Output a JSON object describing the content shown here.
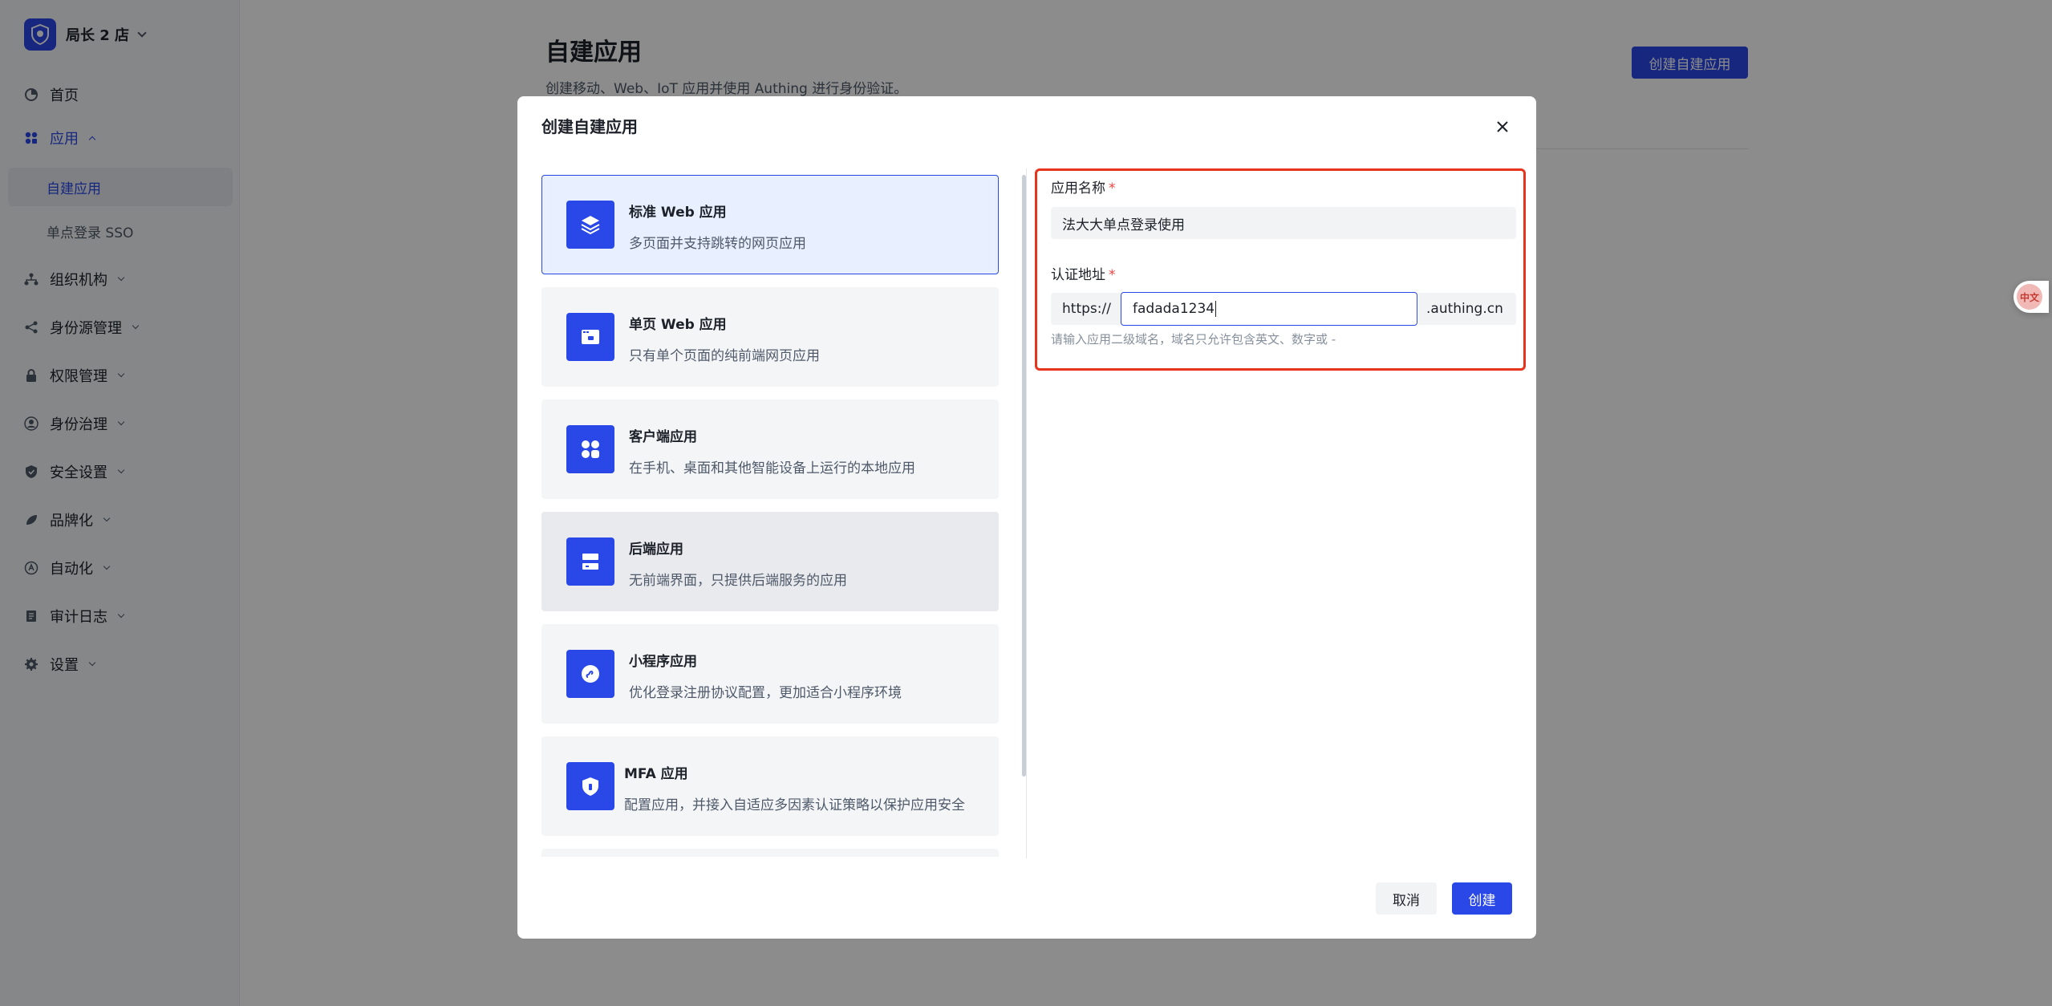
{
  "colors": {
    "primary": "#2a48e8",
    "highlight_box": "#e8341c",
    "required": "#f53f3f"
  },
  "sidebar": {
    "tenant_name": "局长 2 店",
    "items": [
      {
        "label": "首页",
        "icon": "home-icon"
      },
      {
        "label": "应用",
        "icon": "apps-icon",
        "children": [
          {
            "label": "自建应用"
          },
          {
            "label": "单点登录 SSO"
          }
        ]
      },
      {
        "label": "组织机构",
        "icon": "org-icon"
      },
      {
        "label": "身份源管理",
        "icon": "share-icon"
      },
      {
        "label": "权限管理",
        "icon": "lock-icon"
      },
      {
        "label": "身份治理",
        "icon": "user-icon"
      },
      {
        "label": "安全设置",
        "icon": "shield-icon"
      },
      {
        "label": "品牌化",
        "icon": "brand-icon"
      },
      {
        "label": "自动化",
        "icon": "automation-icon"
      },
      {
        "label": "审计日志",
        "icon": "log-icon"
      },
      {
        "label": "设置",
        "icon": "gear-icon"
      }
    ]
  },
  "main": {
    "title": "自建应用",
    "description": "创建移动、Web、IoT 应用并使用 Authing 进行身份验证。",
    "create_button": "创建自建应用"
  },
  "float_button": "中文",
  "modal": {
    "title": "创建自建应用",
    "app_types": [
      {
        "title": "标准 Web 应用",
        "desc": "多页面并支持跳转的网页应用",
        "icon": "layers-icon"
      },
      {
        "title": "单页 Web 应用",
        "desc": "只有单个页面的纯前端网页应用",
        "icon": "browser-window-icon"
      },
      {
        "title": "客户端应用",
        "desc": "在手机、桌面和其他智能设备上运行的本地应用",
        "icon": "app-grid-icon"
      },
      {
        "title": "后端应用",
        "desc": "无前端界面，只提供后端服务的应用",
        "icon": "server-icon"
      },
      {
        "title": "小程序应用",
        "desc": "优化登录注册协议配置，更加适合小程序环境",
        "icon": "mini-program-icon"
      },
      {
        "title": "MFA 应用",
        "desc": "配置应用，并接入自适应多因素认证策略以保护应用安全",
        "icon": "shield-lock-icon"
      }
    ],
    "form": {
      "name_label": "应用名称",
      "name_value": "法大大单点登录使用",
      "domain_label": "认证地址",
      "domain_prefix": "https://",
      "domain_value": "fadada1234",
      "domain_suffix": ".authing.cn",
      "domain_hint": "请输入应用二级域名，域名只允许包含英文、数字或 -",
      "required_mark": "*"
    },
    "cancel_label": "取消",
    "create_label": "创建"
  }
}
